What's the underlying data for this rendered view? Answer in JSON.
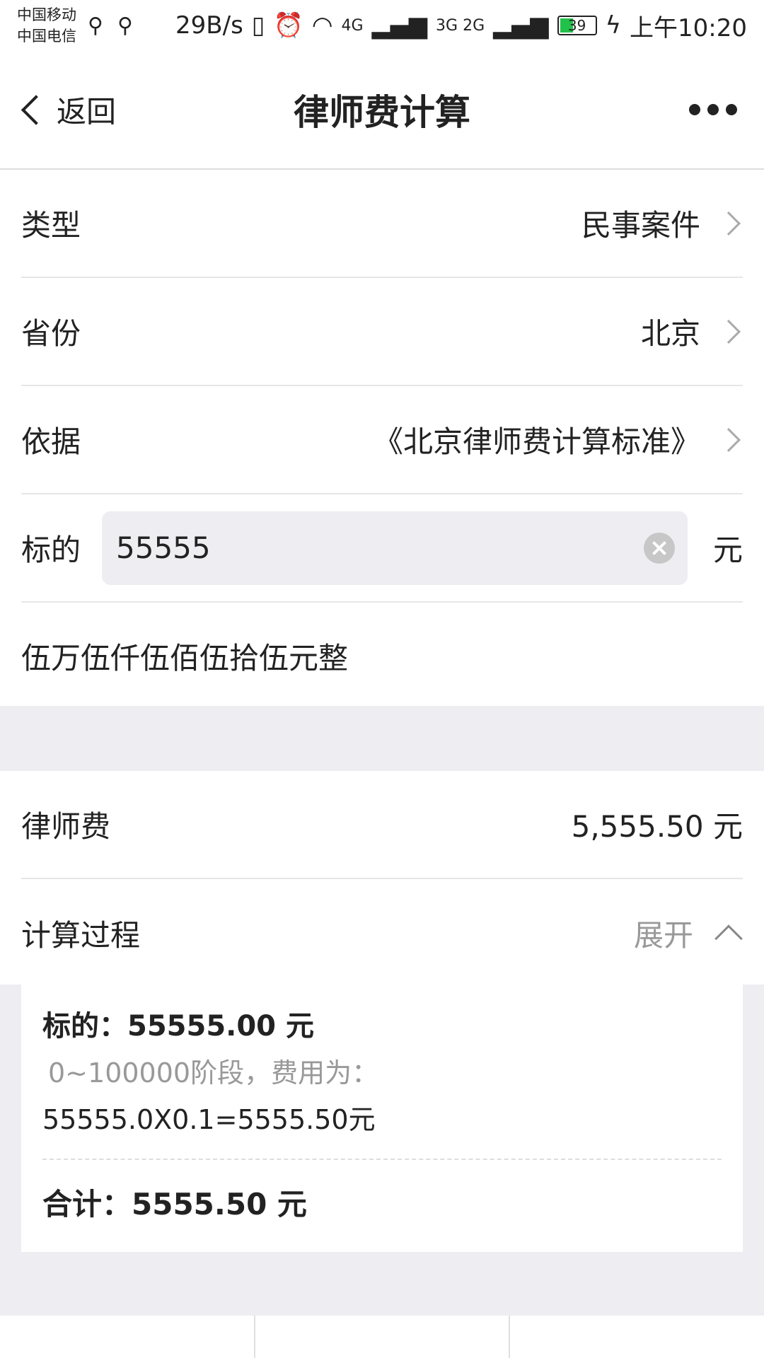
{
  "status_bar": {
    "carrier1": "中国移动",
    "carrier2": "中国电信",
    "speed": "29B/s",
    "network1": "4G",
    "network2": "3G 2G",
    "battery": "39",
    "time": "上午10:20"
  },
  "nav": {
    "back_label": "返回",
    "title": "律师费计算"
  },
  "form": {
    "type_label": "类型",
    "type_value": "民事案件",
    "province_label": "省份",
    "province_value": "北京",
    "basis_label": "依据",
    "basis_value": "《北京律师费计算标准》",
    "amount_label": "标的",
    "amount_value": "55555",
    "amount_unit": "元",
    "amount_words": "伍万伍仟伍佰伍拾伍元整"
  },
  "result": {
    "fee_label": "律师费",
    "fee_value": "5,555.50 元",
    "process_label": "计算过程",
    "expand_label": "展开"
  },
  "process": {
    "subject": "标的：55555.00 元",
    "stage": "0~100000阶段，费用为：",
    "formula": "55555.0X0.1=5555.50元",
    "total": "合计：5555.50 元"
  },
  "colors": {
    "accent_gray": "#eeeef2",
    "battery_green": "#22c24a"
  }
}
